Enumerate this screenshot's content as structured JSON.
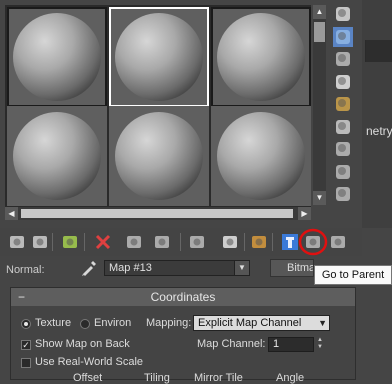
{
  "slots": [
    {
      "active": false,
      "boxed": true
    },
    {
      "active": true,
      "boxed": false
    },
    {
      "active": false,
      "boxed": true
    },
    {
      "active": false,
      "boxed": false
    },
    {
      "active": false,
      "boxed": false
    },
    {
      "active": false,
      "boxed": false
    }
  ],
  "side_tools": [
    "sample-type-sphere-icon",
    "backlight-icon",
    "background-checker-icon",
    "sample-uv-tiling-icon",
    "video-color-check-icon",
    "make-preview-icon",
    "options-icon",
    "select-by-material-icon",
    "material-map-navigator-icon"
  ],
  "side_panel": {
    "props_text": "netry (A"
  },
  "toolbar_tools": [
    "get-material-icon",
    "put-to-scene-icon",
    "assign-to-selection-icon",
    "reset-map-icon",
    "make-copy-icon",
    "make-unique-icon",
    "put-to-library-icon",
    "material-id-channel-icon",
    "show-in-viewport-icon",
    "show-end-result-icon",
    "go-to-parent-icon",
    "go-forward-to-sibling-icon"
  ],
  "name_row": {
    "label": "Normal:",
    "map_name": "Map #13",
    "type_button": "Bitmap"
  },
  "tooltip": "Go to Parent",
  "coordinates": {
    "title": "Coordinates",
    "collapse": "−",
    "texture_label": "Texture",
    "environ_label": "Environ",
    "mapping_label": "Mapping:",
    "mapping_value": "Explicit Map Channel",
    "show_map_on_back": "Show Map on Back",
    "use_real_world_scale": "Use Real-World Scale",
    "map_channel_label": "Map Channel:",
    "map_channel_value": "1",
    "col_offset": "Offset",
    "col_tiling": "Tiling",
    "col_mirror_tile": "Mirror Tile",
    "col_angle": "Angle"
  }
}
